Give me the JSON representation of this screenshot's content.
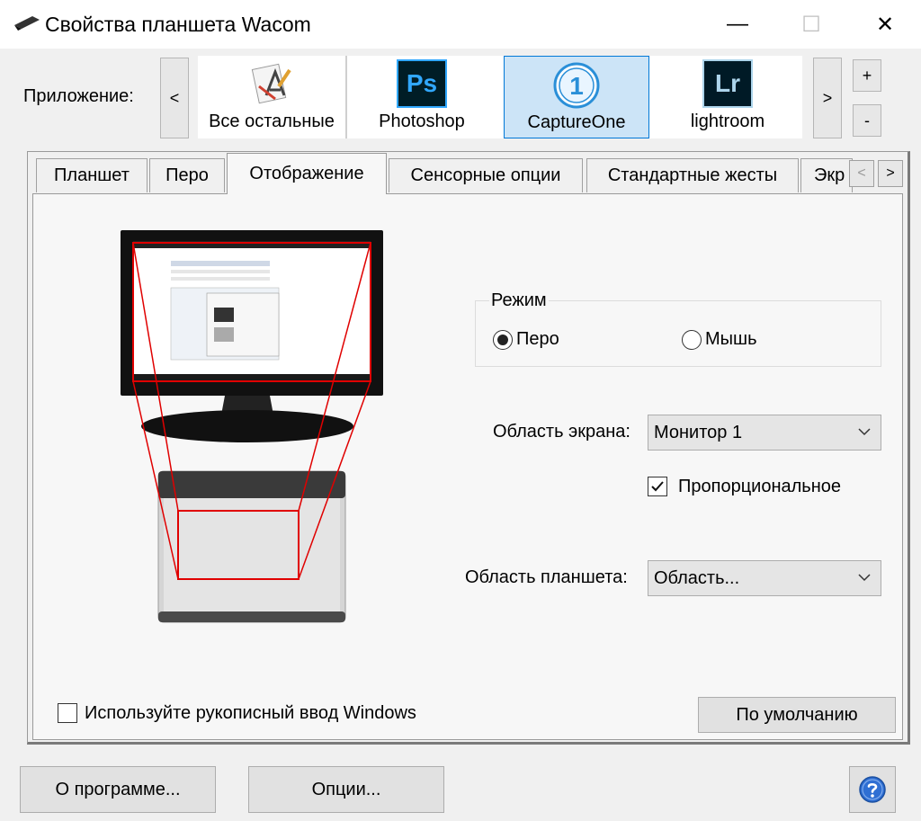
{
  "window": {
    "title": "Свойства планшета Wacom",
    "minimize_glyph": "—",
    "maximize_glyph": "☐",
    "close_glyph": "✕"
  },
  "applications": {
    "label": "Приложение:",
    "scroll_left": "<",
    "scroll_right": ">",
    "add": "+",
    "remove": "-",
    "items": [
      {
        "name": "Все остальные",
        "icon": "all-apps-icon"
      },
      {
        "name": "Photoshop",
        "icon": "photoshop-icon",
        "icon_text": "Ps"
      },
      {
        "name": "CaptureOne",
        "icon": "captureone-icon",
        "icon_text": "1",
        "selected": true
      },
      {
        "name": "lightroom",
        "icon": "lightroom-icon",
        "icon_text": "Lr"
      }
    ]
  },
  "tabs": {
    "items": [
      "Планшет",
      "Перо",
      "Отображение",
      "Сенсорные опции",
      "Стандартные жесты",
      "Экр"
    ],
    "active": "Отображение",
    "scroll_left": "<",
    "scroll_right": ">"
  },
  "mapping": {
    "mode_legend": "Режим",
    "mode_pen": "Перо",
    "mode_mouse": "Мышь",
    "mode_selected": "Перо",
    "screen_area_label": "Область экрана:",
    "screen_area_value": "Монитор 1",
    "proportional_label": "Пропорциональное",
    "proportional_checked": true,
    "tablet_area_label": "Область планшета:",
    "tablet_area_value": "Область...",
    "windows_ink_label": "Используйте рукописный ввод Windows",
    "windows_ink_checked": false,
    "default_button": "По умолчанию"
  },
  "footer": {
    "about_button": "О программе...",
    "options_button": "Опции...",
    "help_icon": "help-icon"
  },
  "colors": {
    "accent": "#0078d7",
    "selected_tile": "#cce4f7",
    "mapping_lines": "#e00000"
  }
}
